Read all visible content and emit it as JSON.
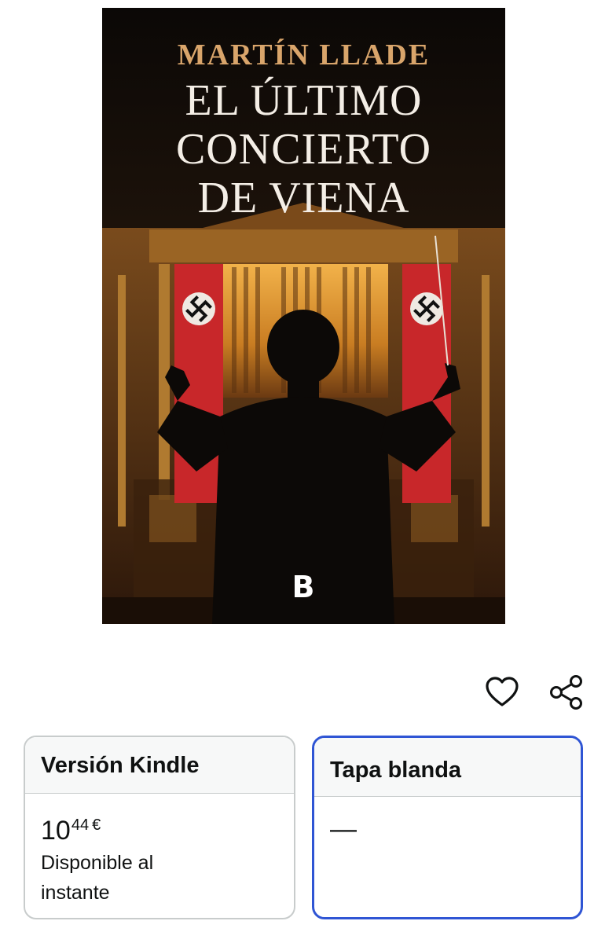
{
  "cover": {
    "author": "MARTÍN LLADE",
    "title_lines": [
      "EL ÚLTIMO",
      "CONCIERTO",
      "DE VIENA"
    ],
    "publisher_logo": "B"
  },
  "actions": {
    "wishlist_icon": "heart-outline-icon",
    "share_icon": "share-icon"
  },
  "formats": [
    {
      "name": "Versión Kindle",
      "price_whole": "10",
      "price_fraction": "44",
      "currency": "€",
      "availability_line1": "Disponible al",
      "availability_line2": "instante",
      "selected": false
    },
    {
      "name": "Tapa blanda",
      "price_placeholder": "—",
      "selected": true
    }
  ],
  "colors": {
    "selected_border": "#2f55d4",
    "card_border": "#c8cccc",
    "author_gold": "#d9a56b",
    "banner_red": "#c8272a"
  }
}
